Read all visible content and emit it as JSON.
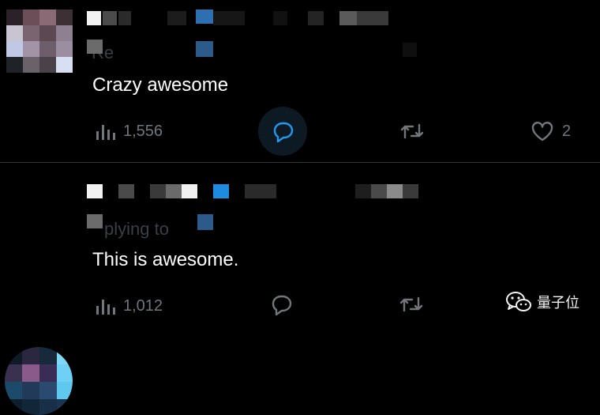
{
  "replies": [
    {
      "text": "Crazy awesome",
      "views": "1,556",
      "likes": "2",
      "replying_prefix_fragment": "Re"
    },
    {
      "text": "This is awesome.",
      "views": "1,012",
      "likes": "",
      "replying_prefix_fragment": "plying to"
    }
  ],
  "icons": {
    "views": "views-chart-icon",
    "reply": "reply-bubble-icon",
    "retweet": "retweet-icon",
    "like": "heart-icon"
  },
  "watermark": {
    "text": "量子位"
  },
  "colors": {
    "background": "#000000",
    "text": "#ffffff",
    "muted": "#71767b",
    "accent": "#1d9bf0",
    "divider": "#2f3336"
  }
}
